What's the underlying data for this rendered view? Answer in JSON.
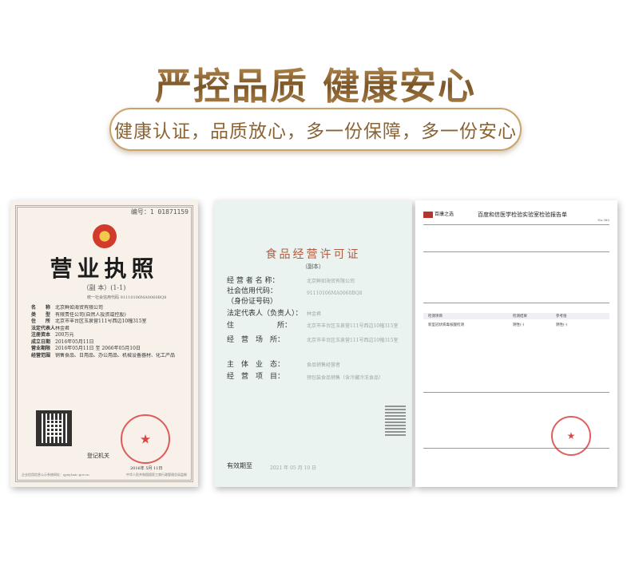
{
  "header": {
    "headline": "严控品质 健康安心",
    "tagline": "健康认证，品质放心，多一份保障，多一份安心"
  },
  "business_license": {
    "serial": "编号：1 01871159",
    "title": "营业执照",
    "subtitle": "（副 本）(1-1)",
    "credit_code": "统一社会信用代码 91110106MA0060BQ8",
    "rows": [
      {
        "key": "名　　称",
        "value": "北京鲜如海贸有限公司"
      },
      {
        "key": "类　　型",
        "value": "有限责任公司(自然人投资或控股)"
      },
      {
        "key": "住　　所",
        "value": "北京市丰台区玉泉营111号西边10幢315室"
      },
      {
        "key": "法定代表人",
        "value": "林金君"
      },
      {
        "key": "注册资本",
        "value": "200万元"
      },
      {
        "key": "成立日期",
        "value": "2016年05月11日"
      },
      {
        "key": "营业期限",
        "value": "2016年05月11日 至 2066年05月10日"
      },
      {
        "key": "经营范围",
        "value": "销售食品、日用品、办公用品、机械设备器材、化工产品"
      }
    ],
    "registration_authority": "登记机关",
    "date_partial": "2016年 5月 11日",
    "footer_left": "企业信用信息公示系统网址：qyxy.baic.gov.cn",
    "footer_right": "中华人民共和国国家工商行政管理总局监制"
  },
  "food_license": {
    "title": "食品经营许可证",
    "subtitle": "（副本）",
    "rows": [
      {
        "key": "经 营 者 名 称：",
        "value": "北京鲜如海贸有限公司"
      },
      {
        "key": "社会信用代码：",
        "value": "91110106MA0060BQ8"
      },
      {
        "key": "（身份证号码）",
        "value": ""
      },
      {
        "key": "法定代表人（负责人）：",
        "value": "林金君"
      },
      {
        "key": "住　　　　　　所：",
        "value": "北京市丰台区玉泉营111号西边10幢315室"
      },
      {
        "key": "经　营　场　所：",
        "value": "北京市丰台区玉泉营111号西边10幢315室"
      },
      {
        "key": "主　体　业　态：",
        "value": "食品销售经营者"
      },
      {
        "key": "经　营　项　目：",
        "value": "预包装食品销售（含冷藏冷冻食品）"
      }
    ],
    "valid_label": "有效期至",
    "valid_value": "2021 年 05 月 10 日"
  },
  "lab_report": {
    "logo": "百康之选",
    "title": "百度和信医学检验实验室检验报告单",
    "number": "No.380",
    "table_header": [
      "检测项目",
      "检测结果",
      "参考值"
    ],
    "result_row": [
      "新型冠状病毒核酸检测",
      "阴性(-)",
      "阴性(-)"
    ]
  },
  "colors": {
    "gold": "#8a6434",
    "pill_border": "#c9a26c",
    "stamp_red": "#d62828",
    "food_bg": "#eaf3ef",
    "license_bg": "#f7f1ea"
  }
}
